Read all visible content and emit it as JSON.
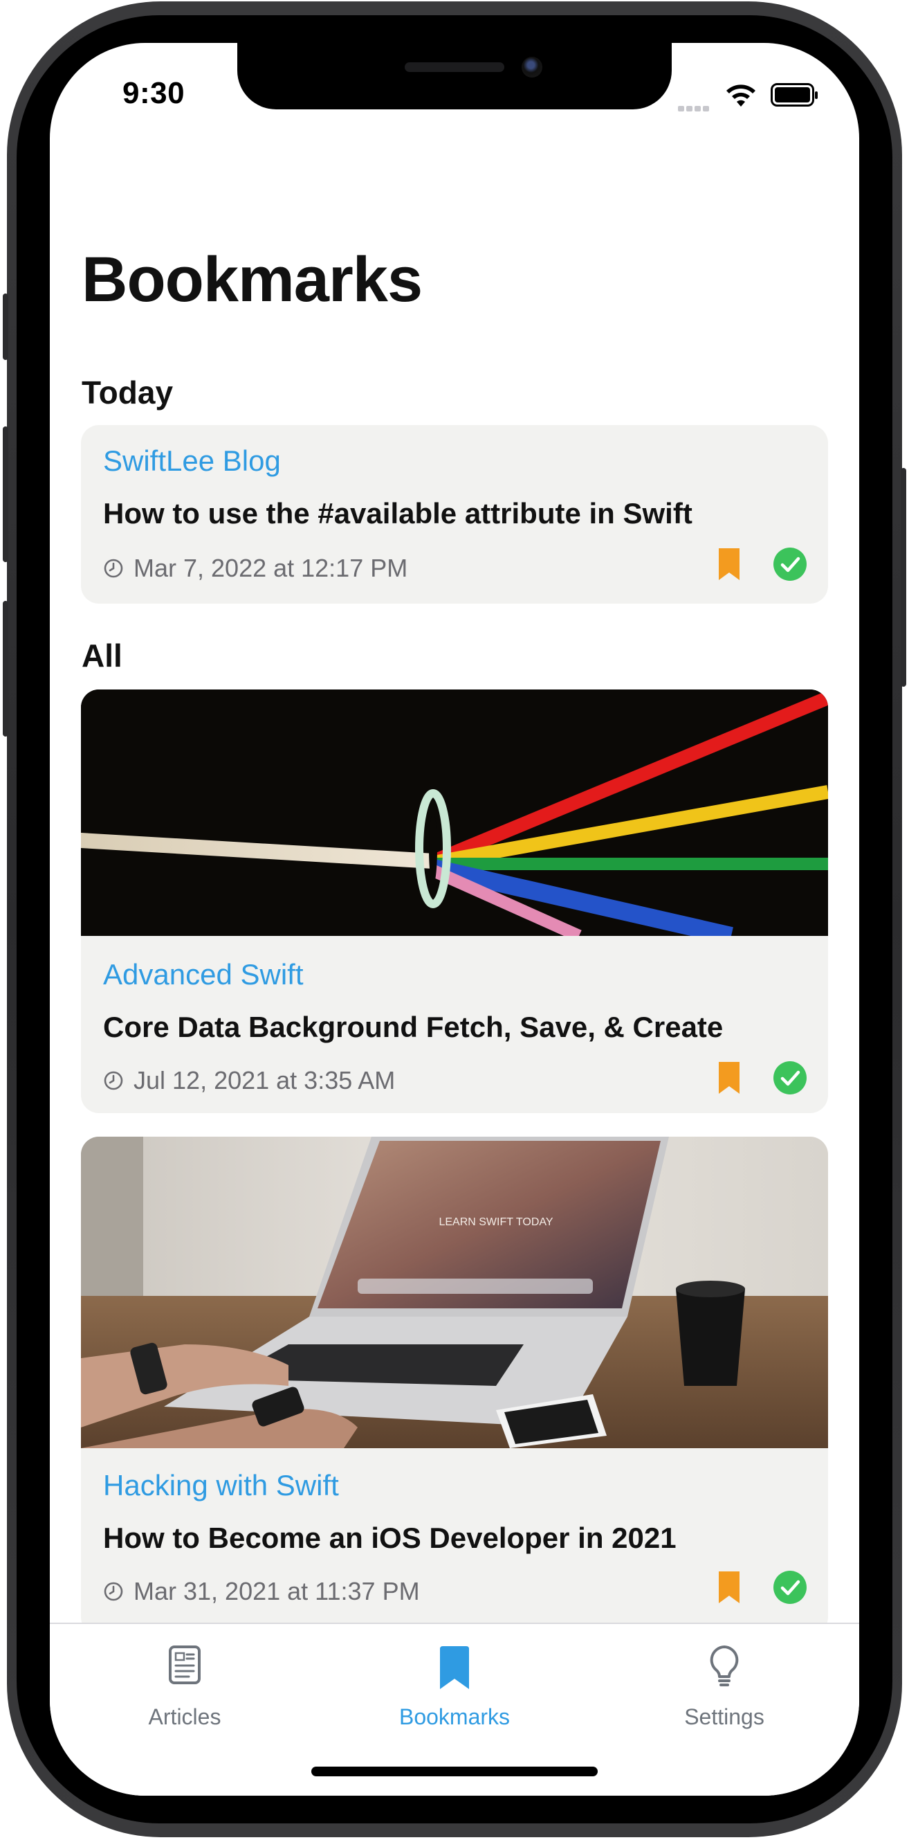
{
  "status_bar": {
    "time": "9:30"
  },
  "page": {
    "title": "Bookmarks"
  },
  "sections": {
    "today": "Today",
    "all": "All"
  },
  "cards": [
    {
      "source": "SwiftLee Blog",
      "title": "How to use the #available attribute in Swift",
      "date": "Mar 7, 2022 at 12:17 PM",
      "has_image": false
    },
    {
      "source": "Advanced Swift",
      "title": "Core Data Background Fetch, Save, & Create",
      "date": "Jul 12, 2021 at 3:35 AM",
      "has_image": true
    },
    {
      "source": "Hacking with Swift",
      "title": "How to Become an iOS Developer in 2021",
      "date": "Mar 31, 2021 at 11:37 PM",
      "has_image": true,
      "image_text": "LEARN SWIFT TODAY"
    }
  ],
  "tabs": [
    {
      "label": "Articles",
      "icon": "newspaper-icon",
      "selected": false
    },
    {
      "label": "Bookmarks",
      "icon": "bookmark-icon",
      "selected": true
    },
    {
      "label": "Settings",
      "icon": "lightbulb-icon",
      "selected": false
    }
  ],
  "colors": {
    "accent": "#2f9be2",
    "tab_selected": "#2f9be2",
    "tab_unselected": "#6e747c",
    "bookmark": "#f39b1f",
    "read_check": "#3cc35b",
    "card_background": "#f2f2f0"
  }
}
